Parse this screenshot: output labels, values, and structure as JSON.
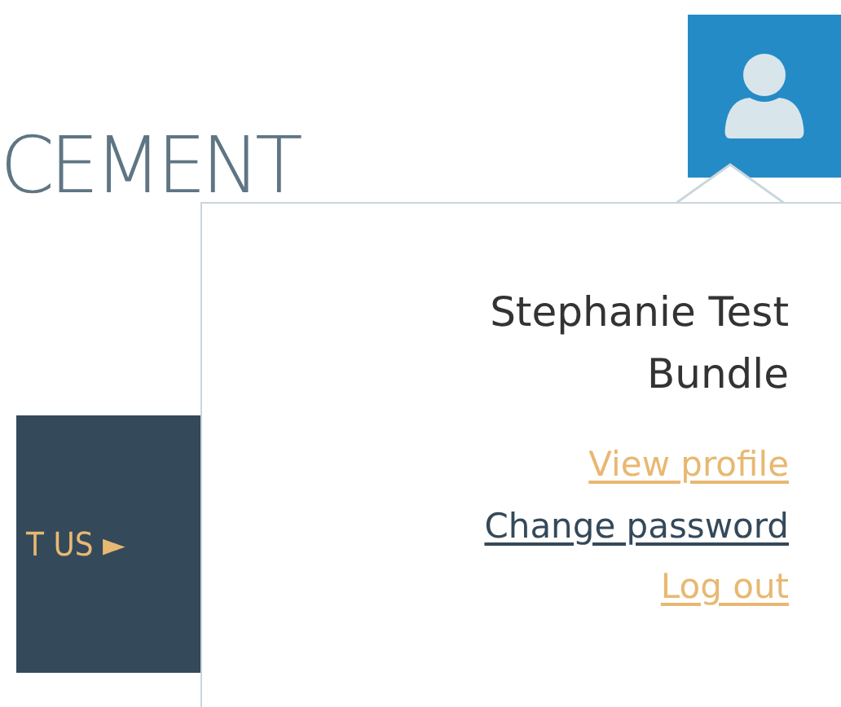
{
  "page_heading": "CEMENT",
  "nav_button": {
    "label": "T US ►"
  },
  "user_menu": {
    "expanded": true,
    "user_name": "Stephanie Test Bundle",
    "links": [
      {
        "label": "View profile",
        "highlighted": false
      },
      {
        "label": "Change password",
        "highlighted": true
      },
      {
        "label": "Log out",
        "highlighted": false
      }
    ]
  }
}
